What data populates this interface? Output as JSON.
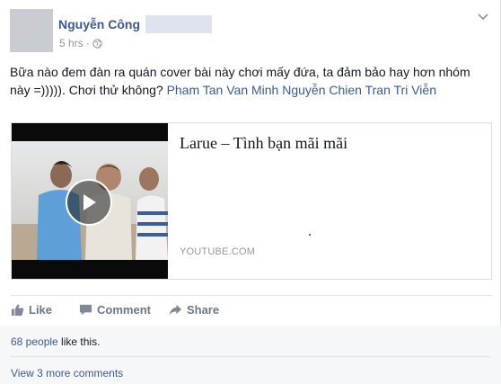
{
  "post": {
    "author": "Nguyễn Công",
    "time": "5 hrs",
    "separator": "·",
    "text_main": "Bữa nào đem đàn ra quán cover bài này chơi mấy đứa, ta đảm bảo hay hơn nhóm này =))))). Chơi thử không? ",
    "tag_1": "Pham Tan Van Minh",
    "tag_2": "Nguyễn Chien Tran",
    "tag_3": "Tri Viễn"
  },
  "attachment": {
    "title": "Larue – Tình bạn mãi mãi",
    "source": "YOUTUBE.COM"
  },
  "actions": {
    "like": "Like",
    "comment": "Comment",
    "share": "Share"
  },
  "ufi": {
    "likes_count": "68 people",
    "likes_suffix": " like this.",
    "view_more": "View 3 more comments"
  },
  "colors": {
    "link": "#3b5998",
    "muted": "#9197a3",
    "action": "#6d7789"
  }
}
